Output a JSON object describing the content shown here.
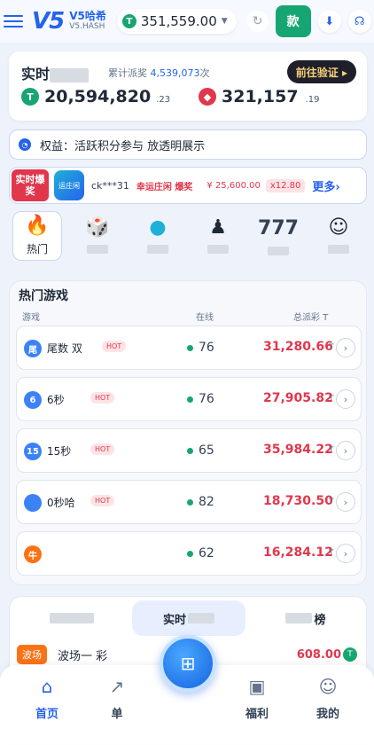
{
  "header": {
    "brand_name": "V5哈希",
    "brand_sub": "V5.HASH",
    "logo": "V5",
    "balance": "351,559.00",
    "coin_symbol": "T",
    "deposit_label": "款",
    "icons": [
      "menu-icon",
      "refresh-icon",
      "download-icon",
      "headset-icon"
    ]
  },
  "stats": {
    "title": "实时",
    "total_label": "累计派奖",
    "total_value": "4,539,073",
    "total_suffix": "次",
    "verify_label": "前往验证 ▸",
    "left_value": "20,594,820",
    "left_decimal": ".23",
    "right_value": "321,157",
    "right_decimal": ".19"
  },
  "notice": {
    "text": "权益：活跃积分参与 放透明展示"
  },
  "ticker": {
    "tag": "实时爆奖",
    "game_icon_label": "运庄闲",
    "user": "ck***31",
    "win_text": "幸运庄闲 爆奖",
    "amount": "¥ 25,600.00",
    "multiplier": "x12.80",
    "more_label": "更多›"
  },
  "categories": [
    {
      "label": "热门",
      "icon": "fire-icon",
      "glyph": "🔥",
      "active": true
    },
    {
      "label": "",
      "icon": "dice-icon",
      "glyph": "🎲",
      "active": false
    },
    {
      "label": "",
      "icon": "ball-icon",
      "glyph": "●",
      "active": false
    },
    {
      "label": "",
      "icon": "chess-icon",
      "glyph": "♟",
      "active": false
    },
    {
      "label": "",
      "icon": "slot-777-icon",
      "glyph": "777",
      "active": false
    },
    {
      "label": "",
      "icon": "dealer-icon",
      "glyph": "☺",
      "active": false
    }
  ],
  "hot_games": {
    "title": "热门游戏",
    "col_game": "游戏",
    "col_online": "在线",
    "col_prize": "总派彩 T",
    "hot_badge": "HOT",
    "unit": "T",
    "rows": [
      {
        "icon_text": "尾",
        "icon_color": "#3b82f6",
        "name": "尾数 双",
        "hot": true,
        "online": "76",
        "prize": "31,280.66"
      },
      {
        "icon_text": "6",
        "icon_color": "#3b82f6",
        "name": "6秒",
        "hot": true,
        "online": "76",
        "prize": "27,905.82"
      },
      {
        "icon_text": "15",
        "icon_color": "#3b82f6",
        "name": "15秒",
        "hot": true,
        "online": "65",
        "prize": "35,984.22"
      },
      {
        "icon_text": "",
        "icon_color": "#3b82f6",
        "name": "0秒哈",
        "hot": true,
        "online": "82",
        "prize": "18,730.50"
      },
      {
        "icon_text": "牛",
        "icon_color": "#f97316",
        "name": "",
        "hot": false,
        "online": "62",
        "prize": "16,284.12"
      }
    ]
  },
  "tabs": {
    "items": [
      "",
      "实时",
      "榜"
    ],
    "feed_tag": "波场",
    "feed_game": "波场一 彩",
    "feed_value": "608.00"
  },
  "nav": {
    "items": [
      {
        "label": "首页",
        "icon": "home-icon",
        "glyph": "⌂",
        "active": true
      },
      {
        "label": "单",
        "icon": "trend-icon",
        "glyph": "↗",
        "active": false
      },
      {
        "label": "",
        "icon": "game-center-icon",
        "glyph": "",
        "active": false
      },
      {
        "label": "福利",
        "icon": "gift-icon",
        "glyph": "🎁",
        "active": false
      },
      {
        "label": "我的",
        "icon": "user-icon",
        "glyph": "👤",
        "active": false
      }
    ]
  },
  "colors": {
    "primary": "#2563eb",
    "green": "#17a673",
    "red": "#e0374c",
    "gold": "#f9d27b"
  }
}
